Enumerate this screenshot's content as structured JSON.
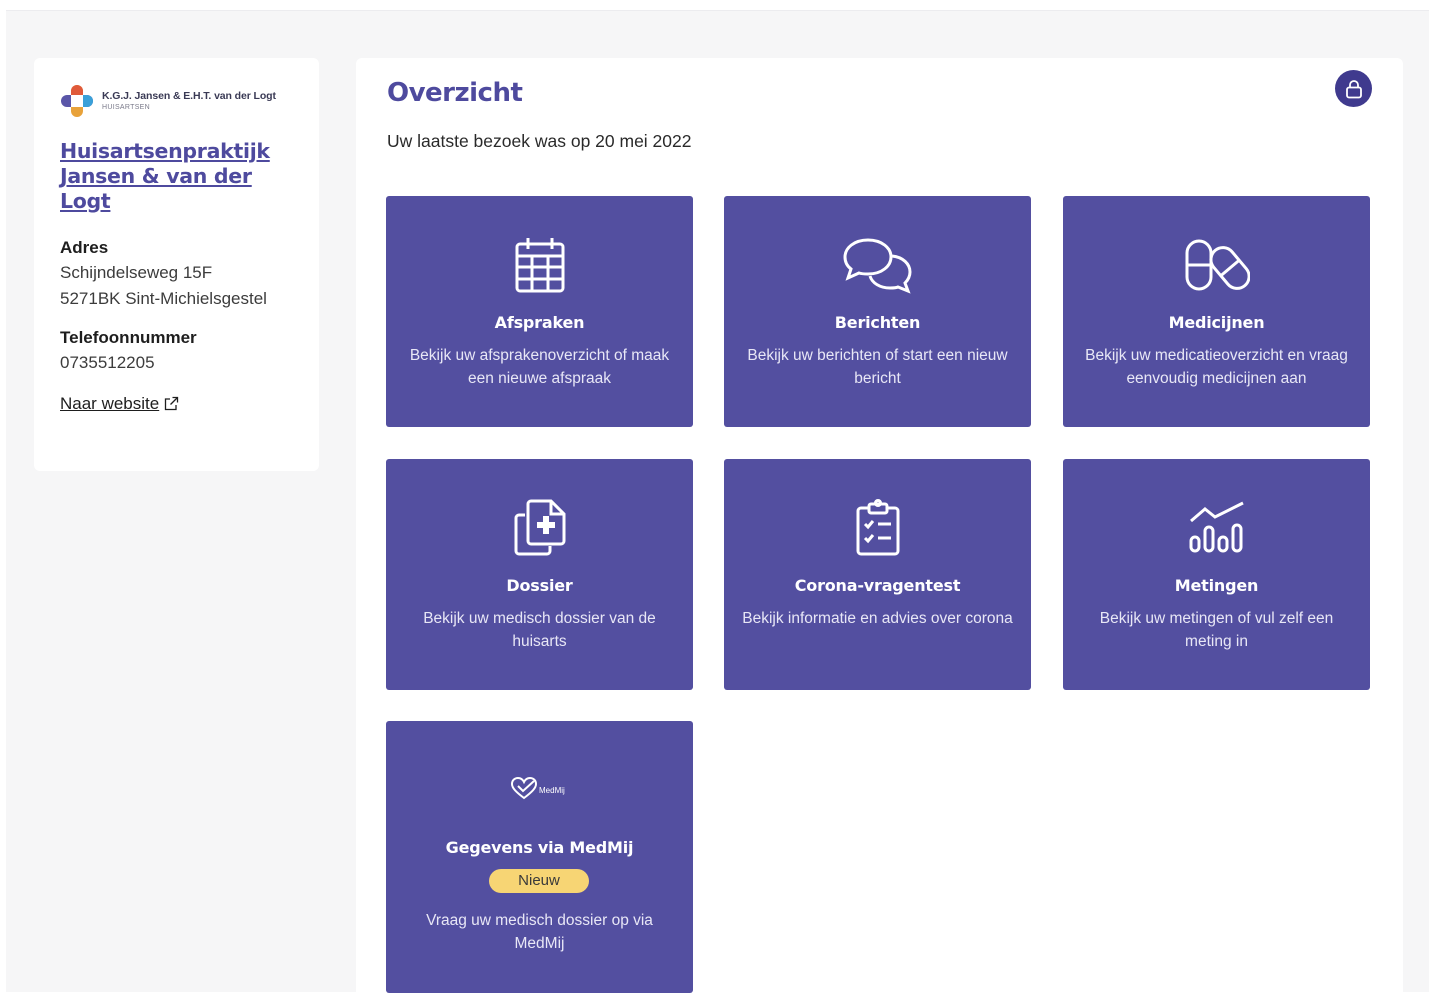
{
  "sidebar": {
    "logo": {
      "name": "K.G.J. Jansen & E.H.T. van der Logt",
      "subtitle": "HUISARTSEN"
    },
    "practice_line1": "Huisartsenpraktijk",
    "practice_line2": "Jansen & van der Logt",
    "address_label": "Adres",
    "address_line1": "Schijndelseweg 15F",
    "address_line2": "5271BK Sint-Michielsgestel",
    "phone_label": "Telefoonnummer",
    "phone": "0735512205",
    "website_link": "Naar website"
  },
  "main": {
    "title": "Overzicht",
    "last_visit": "Uw laatste bezoek was op 20 mei 2022",
    "tiles": [
      {
        "icon": "calendar-icon",
        "title": "Afspraken",
        "desc": "Bekijk uw afsprakenoverzicht of maak een nieuwe afspraak"
      },
      {
        "icon": "chat-bubbles-icon",
        "title": "Berichten",
        "desc": "Bekijk uw berichten of start een nieuw bericht"
      },
      {
        "icon": "pills-icon",
        "title": "Medicijnen",
        "desc": "Bekijk uw medicatieoverzicht en vraag eenvoudig medicijnen aan"
      },
      {
        "icon": "medical-file-icon",
        "title": "Dossier",
        "desc": "Bekijk uw medisch dossier van de huisarts"
      },
      {
        "icon": "checklist-clipboard-icon",
        "title": "Corona-vragentest",
        "desc": "Bekijk informatie en advies over corona"
      },
      {
        "icon": "measurements-chart-icon",
        "title": "Metingen",
        "desc": "Bekijk uw metingen of vul zelf een meting in"
      },
      {
        "icon": "medmij-logo-icon",
        "title": "Gegevens via MedMij",
        "badge": "Nieuw",
        "desc": "Vraag uw medisch dossier op via MedMij"
      }
    ]
  },
  "colors": {
    "brand": "#4e4a9e",
    "tile": "#534fa0",
    "badge": "#f7d574",
    "lock_button": "#3f3a8e"
  }
}
